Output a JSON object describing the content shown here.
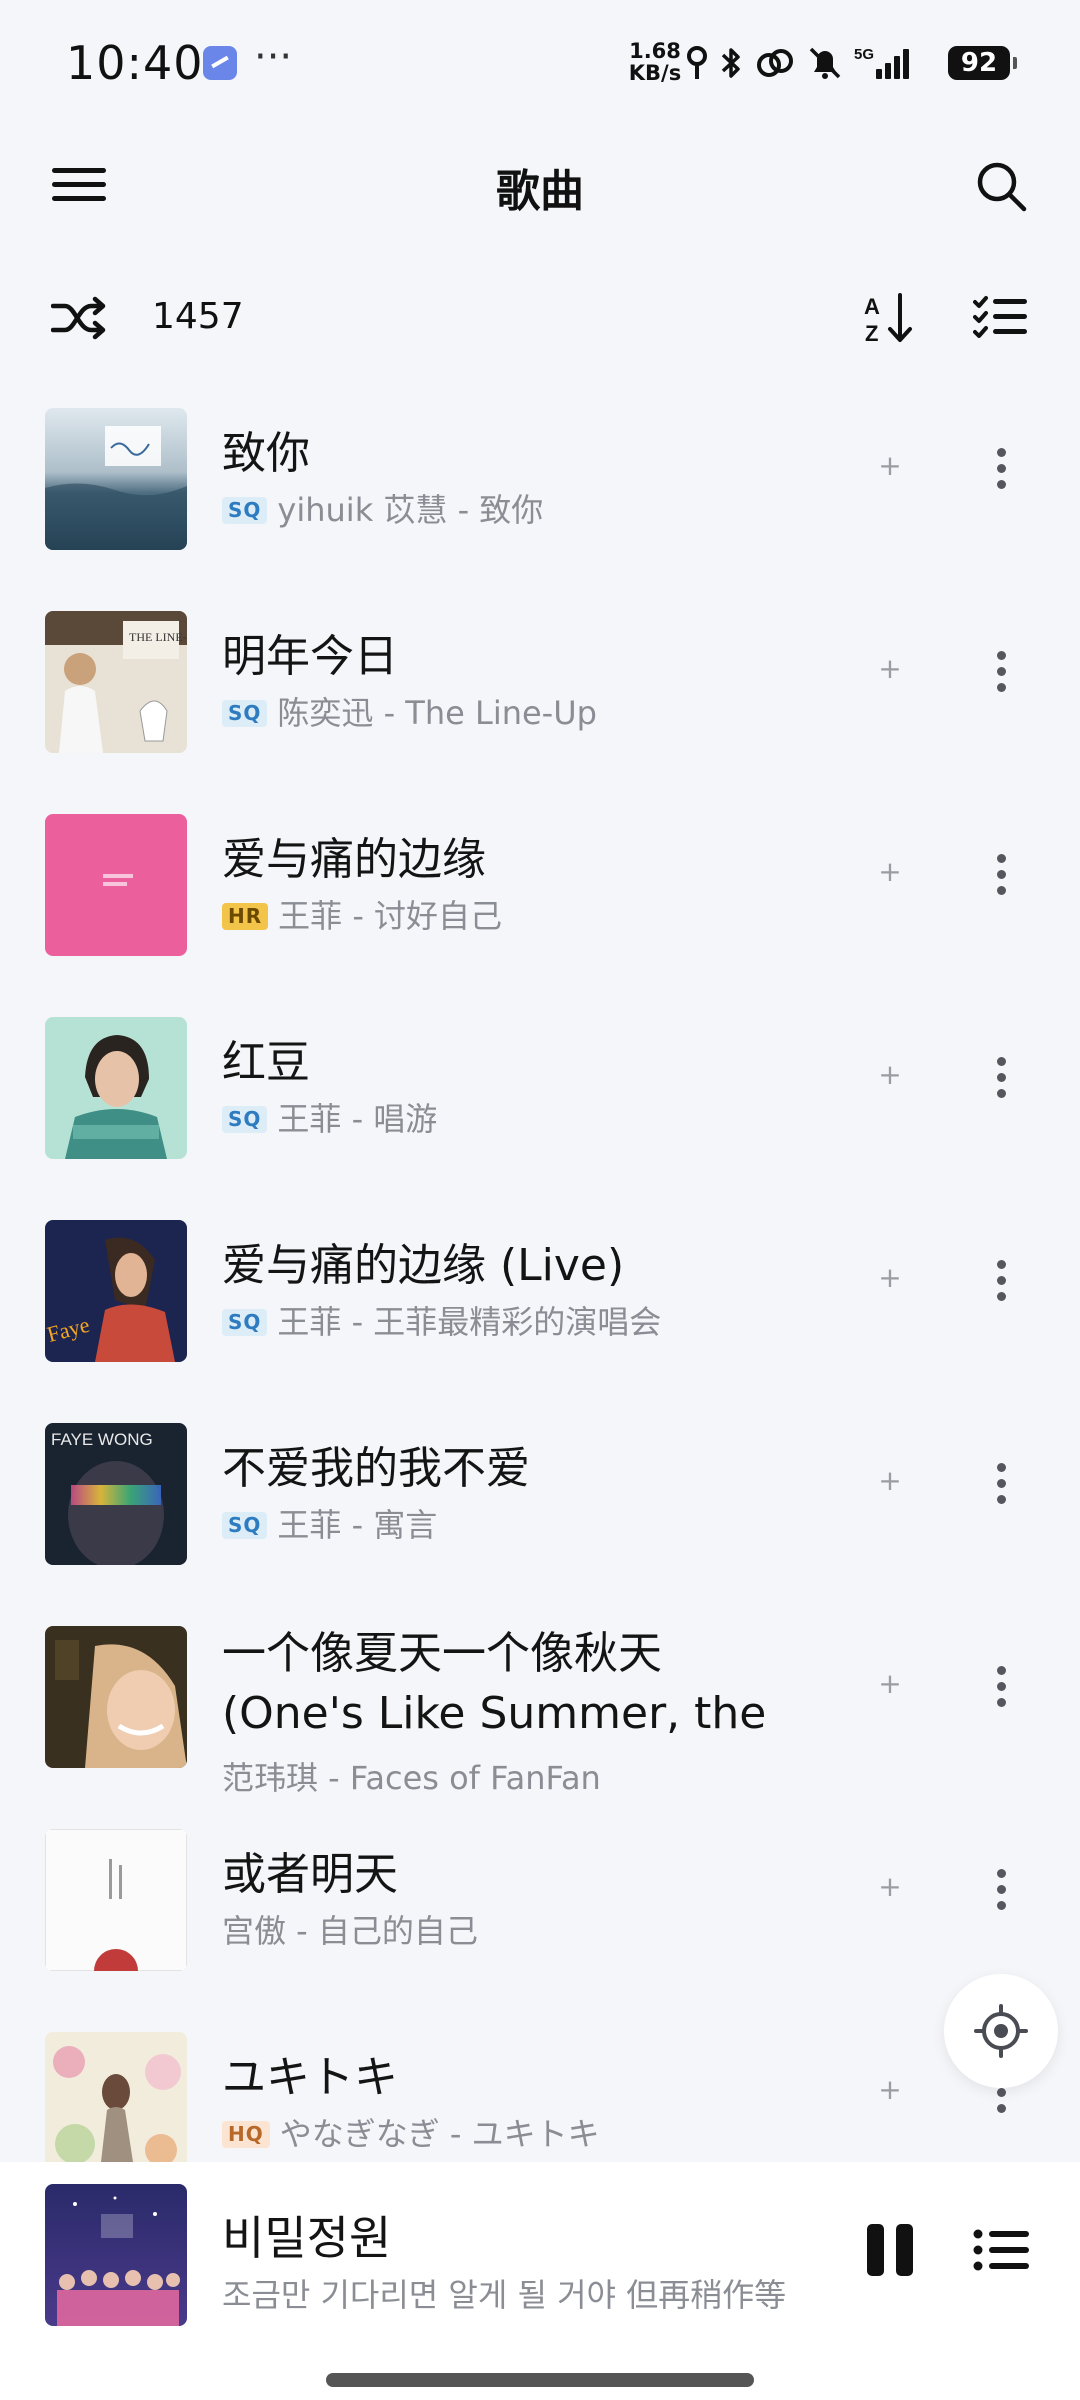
{
  "status_bar": {
    "time": "10:40",
    "more": "···",
    "net_speed_value": "1.68",
    "net_speed_unit": "KB/s",
    "network_type": "5G",
    "battery": "92"
  },
  "header": {
    "title": "歌曲"
  },
  "toolbar": {
    "song_count": "1457"
  },
  "songs": [
    {
      "title": "致你",
      "quality": "SQ",
      "subtitle": "yihuik 苡慧 - 致你"
    },
    {
      "title": "明年今日",
      "quality": "SQ",
      "subtitle": "陈奕迅 - The Line-Up"
    },
    {
      "title": "爱与痛的边缘",
      "quality": "HR",
      "subtitle": "王菲 - 讨好自己"
    },
    {
      "title": "红豆",
      "quality": "SQ",
      "subtitle": "王菲 - 唱游"
    },
    {
      "title": "爱与痛的边缘 (Live)",
      "quality": "SQ",
      "subtitle": "王菲 - 王菲最精彩的演唱会"
    },
    {
      "title": "不爱我的我不爱",
      "quality": "SQ",
      "subtitle": "王菲 - 寓言"
    },
    {
      "title": "一个像夏天一个像秋天 (One's Like Summer, the …",
      "quality": "",
      "subtitle": "范玮琪 - Faces of FanFan"
    },
    {
      "title": "或者明天",
      "quality": "",
      "subtitle": "宫傲 - 自己的自己"
    },
    {
      "title": "ユキトキ",
      "quality": "HQ",
      "subtitle": "やなぎなぎ - ユキトキ"
    }
  ],
  "row_actions": {
    "add": "+"
  },
  "cover_texts": {
    "faye_wong": "FAYE WONG"
  },
  "now_playing": {
    "title": "비밀정원",
    "lyric": "조금만 기다리면 알게 될 거야 但再稍作等"
  },
  "colors": {
    "background": "#f5f6fa",
    "sq_badge": "#2e7bc0",
    "hr_badge": "#f3c44a",
    "hq_badge": "#b8692a",
    "secondary_text": "#8b8d94"
  }
}
